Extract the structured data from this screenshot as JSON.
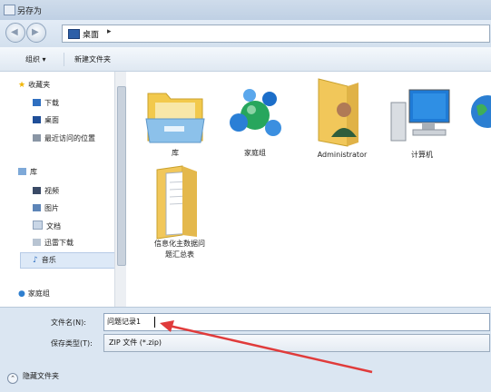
{
  "window": {
    "title": "另存为"
  },
  "address": {
    "path": "桌面",
    "separator": "▸"
  },
  "toolbar": {
    "organize": "组织 ▾",
    "new_folder": "新建文件夹"
  },
  "sidebar": {
    "favorites": {
      "label": "收藏夹",
      "items": [
        "下载",
        "桌面",
        "最近访问的位置"
      ]
    },
    "library": {
      "label": "库",
      "items": [
        "视频",
        "图片",
        "文档",
        "迅雷下载",
        "音乐"
      ]
    },
    "homegroup": "家庭组"
  },
  "files": [
    {
      "label": "库",
      "icon": "library-folder-icon"
    },
    {
      "label": "家庭组",
      "icon": "homegroup-icon"
    },
    {
      "label": "Administrator",
      "icon": "user-folder-icon"
    },
    {
      "label": "计算机",
      "icon": "computer-icon"
    },
    {
      "label": "信息化主数据问题汇总表",
      "label_line1": "信息化主数据问",
      "label_line2": "题汇总表",
      "icon": "document-folder-icon"
    }
  ],
  "form": {
    "filename_label": "文件名(N):",
    "filename_value": "问题记录1",
    "filetype_label": "保存类型(T):",
    "filetype_value": "ZIP 文件 (*.zip)"
  },
  "footer": {
    "hide_folders": "隐藏文件夹"
  },
  "colors": {
    "annotation_arrow": "#e03b3b",
    "selection": "#dde9f7"
  }
}
